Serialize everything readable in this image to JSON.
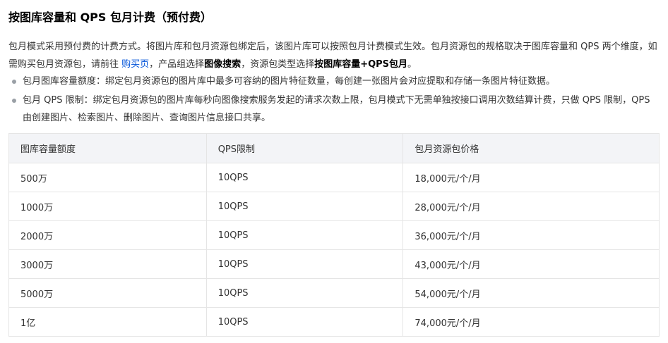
{
  "heading": "按图库容量和 QPS 包月计费（预付费）",
  "intro": {
    "part1": "包月模式采用预付费的计费方式。将图片库和包月资源包绑定后，该图片库可以按照包月计费模式生效。包月资源包的规格取决于图库容量和 QPS 两个维度，如需购买包月资源包，请前往 ",
    "link": "购买页",
    "part2": "，产品组选择",
    "bold1": "图像搜索",
    "part3": "，资源包类型选择",
    "bold2": "按图库容量+QPS包月",
    "part4": "。"
  },
  "bullets": [
    "包月图库容量额度：绑定包月资源包的图片库中最多可容纳的图片特征数量，每创建一张图片会对应提取和存储一条图片特征数据。",
    "包月 QPS 限制：绑定包月资源包的图片库每秒向图像搜索服务发起的请求次数上限，包月模式下无需单独按接口调用次数结算计费，只做 QPS 限制，QPS 由创建图片、检索图片、删除图片、查询图片信息接口共享。"
  ],
  "table": {
    "headers": [
      "图库容量额度",
      "QPS限制",
      "包月资源包价格"
    ],
    "rows": [
      [
        "500万",
        "10QPS",
        "18,000元/个/月"
      ],
      [
        "1000万",
        "10QPS",
        "28,000元/个/月"
      ],
      [
        "2000万",
        "10QPS",
        "36,000元/个/月"
      ],
      [
        "3000万",
        "10QPS",
        "43,000元/个/月"
      ],
      [
        "5000万",
        "10QPS",
        "54,000元/个/月"
      ],
      [
        "1亿",
        "10QPS",
        "74,000元/个/月"
      ]
    ]
  }
}
